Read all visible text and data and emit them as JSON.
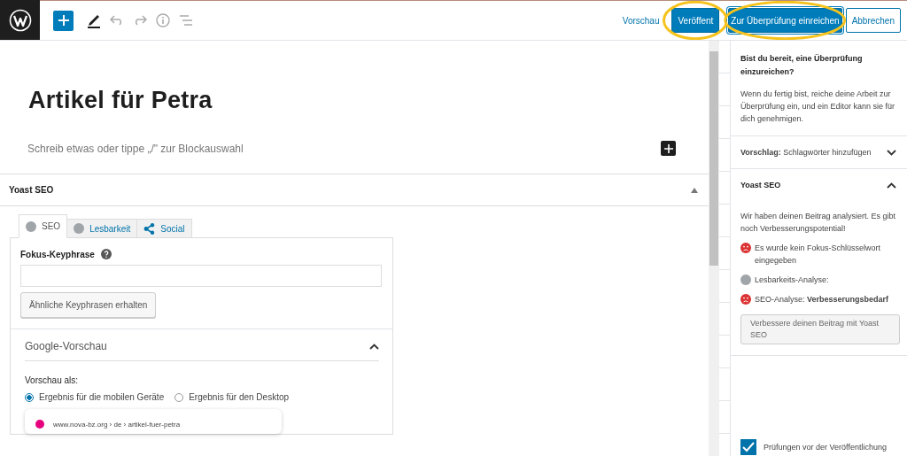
{
  "toolbar": {
    "preview": "Vorschau",
    "publish": "Veröffent",
    "submit": "Zur Überprüfung einreichen",
    "cancel": "Abbrechen"
  },
  "editor": {
    "title": "Artikel für Petra",
    "placeholder": "Schreib etwas oder tippe „/\" zur Blockauswahl"
  },
  "yoast_panel": {
    "title": "Yoast SEO",
    "expanded": true,
    "tabs": [
      {
        "label": "SEO",
        "selected": true,
        "kind": "dot"
      },
      {
        "label": "Lesbarkeit",
        "selected": false,
        "kind": "dot"
      },
      {
        "label": "Social",
        "selected": false,
        "kind": "share"
      }
    ],
    "focus_label": "Fokus-Keyphrase",
    "related_button": "Ähnliche Keyphrasen erhalten",
    "google_preview": {
      "title": "Google-Vorschau",
      "expanded": true,
      "preview_as": "Vorschau als:",
      "options": [
        {
          "label": "Ergebnis für die mobilen Geräte",
          "selected": true
        },
        {
          "label": "Ergebnis für den Desktop",
          "selected": false
        }
      ],
      "url": "www.nova-bz.org › de › artikel-fuer-petra"
    }
  },
  "sidebar": {
    "heading": "Bist du bereit, eine Überprüfung einzureichen?",
    "text": "Wenn du fertig bist, reiche deine Arbeit zur Überprüfung ein, und ein Editor kann sie für dich genehmigen.",
    "suggestion": {
      "text": "**Vorschlag:** Schlagwörter hinzufügen",
      "expanded": false
    },
    "yoast": {
      "title": "Yoast SEO",
      "expanded": true,
      "intro": "Wir haben deinen Beitrag analysiert. Es gibt noch Verbesserungspotential!",
      "results": [
        {
          "kind": "bad",
          "text": "Es wurde kein Fokus-Schlüsselwort eingegeben"
        },
        {
          "kind": "none",
          "text": "Lesbarkeits-Analyse:"
        },
        {
          "kind": "bad",
          "text": "SEO-Analyse: **Verbesserungsbedarf**"
        }
      ],
      "button": "Verbessere deinen Beitrag mit Yoast SEO"
    },
    "prepublish": {
      "label": "Prüfungen vor der Veröffentlichung",
      "checked": true
    }
  }
}
